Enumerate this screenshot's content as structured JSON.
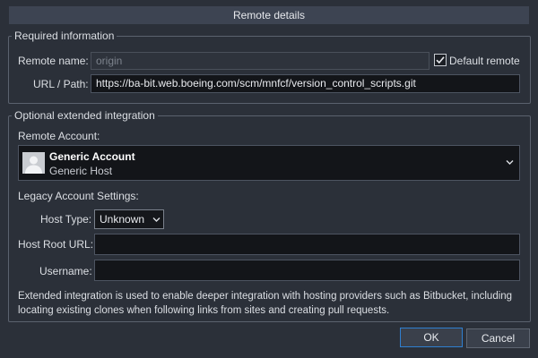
{
  "dialog": {
    "title": "Remote details"
  },
  "required": {
    "legend": "Required information",
    "remote_name_label": "Remote name:",
    "remote_name_value": "origin",
    "default_remote_label": "Default remote",
    "default_remote_checked": true,
    "url_label": "URL / Path:",
    "url_value": "https://ba-bit.web.boeing.com/scm/mnfcf/version_control_scripts.git"
  },
  "optional": {
    "legend": "Optional extended integration",
    "remote_account_label": "Remote Account:",
    "account_name": "Generic Account",
    "account_host": "Generic Host",
    "legacy_label": "Legacy Account Settings:",
    "host_type_label": "Host Type:",
    "host_type_value": "Unknown",
    "host_root_label": "Host Root URL:",
    "host_root_value": "",
    "username_label": "Username:",
    "username_value": "",
    "info_text": "Extended integration is used to enable deeper integration with hosting providers such as Bitbucket, including locating existing clones when following links from sites and creating pull requests."
  },
  "buttons": {
    "ok": "OK",
    "cancel": "Cancel"
  },
  "icons": {
    "default_remote_checkbox": "checkmark-icon",
    "account_avatar": "avatar-icon",
    "account_dropdown": "chevron-down-icon",
    "host_type_dropdown": "chevron-down-icon"
  },
  "colors": {
    "background": "#2b3039",
    "title_bar": "#3d4452",
    "input_background": "#131519",
    "ok_border": "#2f7fd0"
  }
}
